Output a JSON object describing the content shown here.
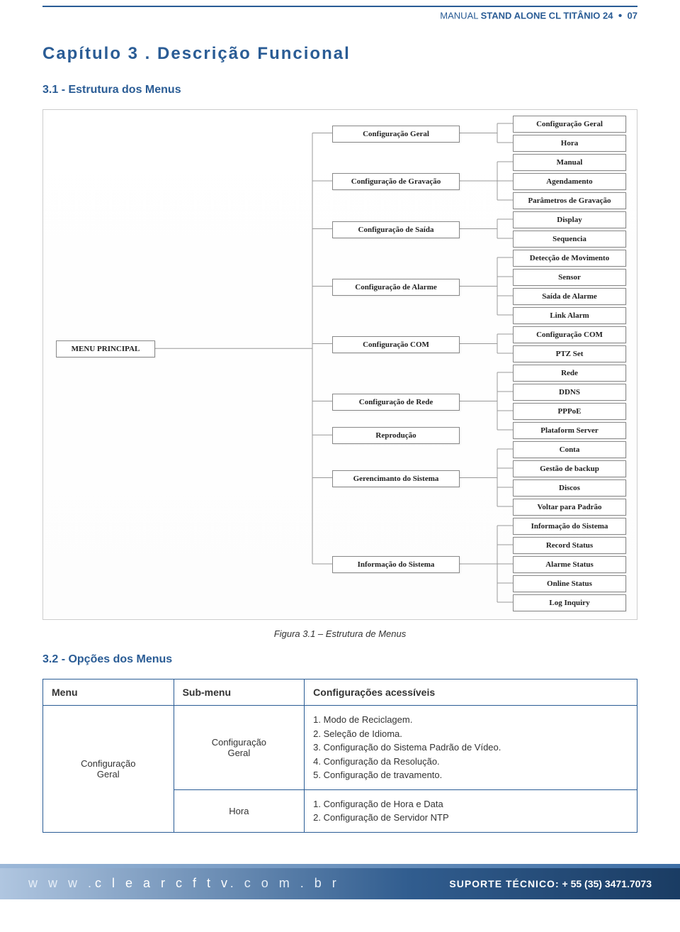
{
  "header": {
    "prefix": "MANUAL",
    "title": "STAND ALONE CL TITÂNIO 24",
    "page": "07"
  },
  "chapter_title": "Capítulo 3 . Descrição Funcional",
  "section1_title": "3.1 - Estrutura dos Menus",
  "figure_caption": "Figura 3.1 – Estrutura de Menus",
  "section2_title": "3.2 - Opções dos Menus",
  "diagram": {
    "root": "MENU PRINCIPAL",
    "mid": [
      "Configuração Geral",
      "Configuração de Gravação",
      "Configuração de Saída",
      "Configuração de Alarme",
      "Configuração COM",
      "Configuração de Rede",
      "Reprodução",
      "Gerencimanto do Sistema",
      "Informação do Sistema"
    ],
    "leaves": [
      "Configuração Geral",
      "Hora",
      "Manual",
      "Agendamento",
      "Parâmetros de Gravação",
      "Display",
      "Sequencia",
      "Detecção de Movimento",
      "Sensor",
      "Saída de Alarme",
      "Link Alarm",
      "Configuração COM",
      "PTZ Set",
      "Rede",
      "DDNS",
      "PPPoE",
      "Plataform Server",
      "Conta",
      "Gestão de backup",
      "Discos",
      "Voltar para Padrão",
      "Informação do Sistema",
      "Record Status",
      "Alarme Status",
      "Online Status",
      "Log Inquiry"
    ]
  },
  "table": {
    "head_menu": "Menu",
    "head_sub": "Sub-menu",
    "head_conf": "Configurações acessíveis",
    "row1_menu": "Configuração Geral",
    "row1_sub": "Configuração Geral",
    "row1_conf": "1. Modo de Reciclagem.\n2. Seleção de Idioma.\n3. Configuração do Sistema Padrão de Vídeo.\n4. Configuração da Resolução.\n5. Configuração de travamento.",
    "row2_sub": "Hora",
    "row2_conf": "1. Configuração de Hora e Data\n2. Configuração de Servidor NTP"
  },
  "footer": {
    "url_w": "w w w .",
    "url_main": "c l e a r c f t v",
    "url_end": ". c o m . b r",
    "support_label": "SUPORTE TÉCNICO:",
    "support_num": "+ 55 (35) 3471.7073"
  }
}
